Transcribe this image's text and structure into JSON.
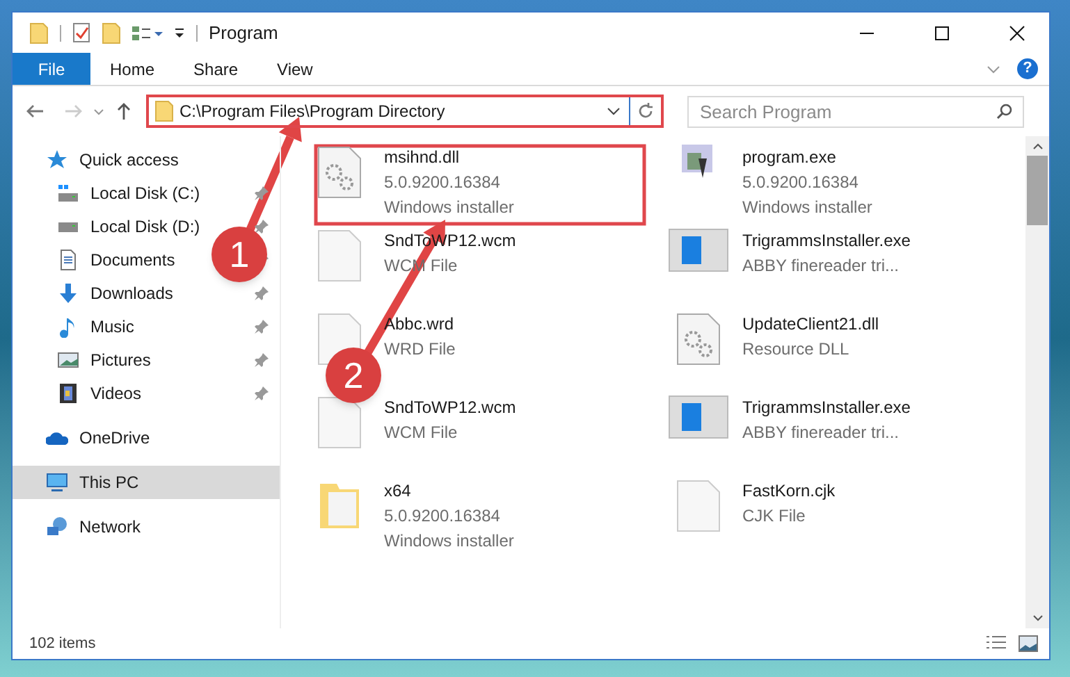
{
  "window": {
    "title": "Program"
  },
  "ribbon": {
    "file_tab": "File",
    "tabs": [
      {
        "label": "Home",
        "selected": false
      },
      {
        "label": "Share",
        "selected": false
      },
      {
        "label": "View",
        "selected": false
      }
    ],
    "help": "?"
  },
  "address_bar": {
    "path": "C:\\Program Files\\Program Directory"
  },
  "search": {
    "placeholder": "Search Program"
  },
  "sidebar": {
    "items": [
      {
        "label": "Quick access",
        "kind": "quick",
        "selected": false,
        "children": [
          {
            "label": "Local Disk (C:)",
            "kind": "diskc",
            "pinned": true
          },
          {
            "label": "Local Disk (D:)",
            "kind": "disk",
            "pinned": true
          },
          {
            "label": "Documents",
            "kind": "documents",
            "pinned": true
          },
          {
            "label": "Downloads",
            "kind": "downloads",
            "pinned": true
          },
          {
            "label": "Music",
            "kind": "music",
            "pinned": true
          },
          {
            "label": "Pictures",
            "kind": "pictures",
            "pinned": true
          },
          {
            "label": "Videos",
            "kind": "videos",
            "pinned": true
          }
        ]
      },
      {
        "label": "OneDrive",
        "kind": "cloud",
        "selected": false
      },
      {
        "label": "This PC",
        "kind": "pc",
        "selected": true
      },
      {
        "label": "Network",
        "kind": "network",
        "selected": false
      }
    ]
  },
  "files": [
    {
      "name": "msihnd.dll",
      "details": [
        "5.0.9200.16384",
        "Windows installer"
      ],
      "kind": "gears"
    },
    {
      "name": "program.exe",
      "details": [
        "5.0.9200.16384",
        "Windows installer"
      ],
      "kind": "app"
    },
    {
      "name": "SndToWP12.wcm",
      "details": [
        "WCM File"
      ],
      "kind": "blank"
    },
    {
      "name": "TrigrammsInstaller.exe",
      "details": [
        "ABBY finereader tri..."
      ],
      "kind": "window"
    },
    {
      "name": "Abbc.wrd",
      "details": [
        "WRD File"
      ],
      "kind": "blank"
    },
    {
      "name": "UpdateClient21.dll",
      "details": [
        "Resource DLL"
      ],
      "kind": "gears"
    },
    {
      "name": "SndToWP12.wcm",
      "details": [
        "WCM File"
      ],
      "kind": "blank"
    },
    {
      "name": "TrigrammsInstaller.exe",
      "details": [
        "ABBY finereader tri..."
      ],
      "kind": "window"
    },
    {
      "name": "x64",
      "details": [
        "5.0.9200.16384",
        "Windows installer"
      ],
      "kind": "folder"
    },
    {
      "name": "FastKorn.cjk",
      "details": [
        "CJK File"
      ],
      "kind": "blank"
    }
  ],
  "status_bar": {
    "count": "102 items"
  },
  "callouts": [
    {
      "number": "1"
    },
    {
      "number": "2"
    }
  ]
}
